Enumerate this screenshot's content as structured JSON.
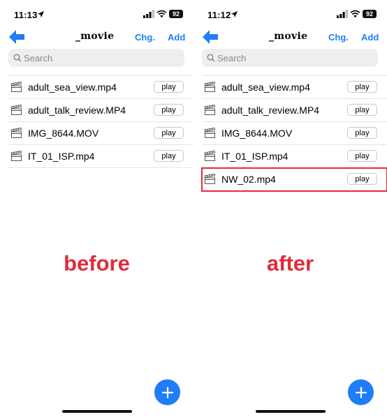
{
  "panels": [
    {
      "status": {
        "time": "11:13",
        "battery": "92"
      },
      "header": {
        "title": "_movie",
        "chg": "Chg.",
        "add": "Add"
      },
      "search": {
        "placeholder": "Search"
      },
      "files": [
        {
          "name": "adult_sea_view.mp4",
          "button": "play"
        },
        {
          "name": "adult_talk_review.MP4",
          "button": "play"
        },
        {
          "name": "IMG_8644.MOV",
          "button": "play"
        },
        {
          "name": "IT_01_ISP.mp4",
          "button": "play"
        }
      ],
      "caption": "before"
    },
    {
      "status": {
        "time": "11:12",
        "battery": "92"
      },
      "header": {
        "title": "_movie",
        "chg": "Chg.",
        "add": "Add"
      },
      "search": {
        "placeholder": "Search"
      },
      "files": [
        {
          "name": "adult_sea_view.mp4",
          "button": "play"
        },
        {
          "name": "adult_talk_review.MP4",
          "button": "play"
        },
        {
          "name": "IMG_8644.MOV",
          "button": "play"
        },
        {
          "name": "IT_01_ISP.mp4",
          "button": "play"
        },
        {
          "name": "NW_02.mp4",
          "button": "play",
          "highlighted": true
        }
      ],
      "caption": "after"
    }
  ],
  "colors": {
    "accent": "#1f7df6",
    "caption": "#e02c3a",
    "highlight": "#e5283a"
  },
  "icons": [
    "location-arrow-icon",
    "cellular-signal-icon",
    "wifi-icon",
    "back-arrow-icon",
    "search-icon",
    "clapperboard-icon",
    "plus-icon"
  ]
}
